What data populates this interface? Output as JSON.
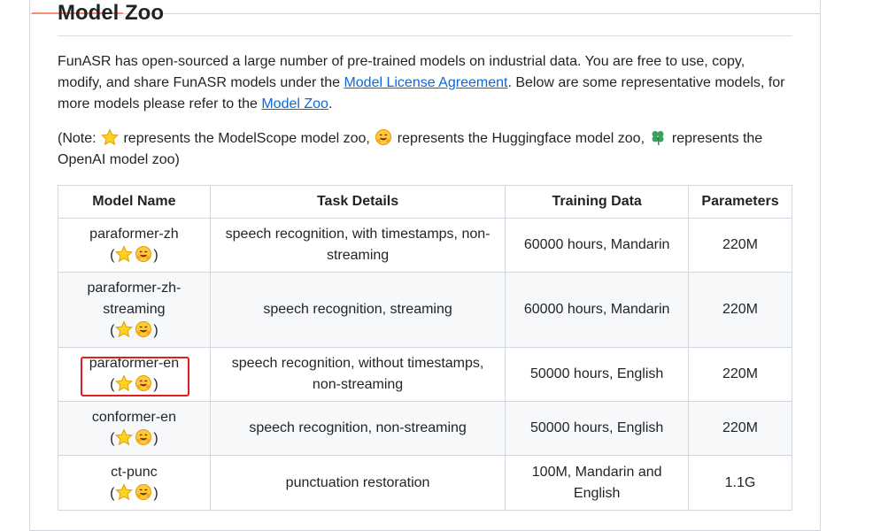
{
  "section": {
    "title": "Model Zoo"
  },
  "intro": {
    "text_before_link1": "FunASR has open-sourced a large number of pre-trained models on industrial data. You are free to use, copy, modify, and share FunASR models under the ",
    "link1": "Model License Agreement",
    "text_between": ". Below are some representative models, for more models please refer to the ",
    "link2": "Model Zoo",
    "text_after": "."
  },
  "note": {
    "part1": "(Note: ",
    "part2": " represents the ModelScope model zoo, ",
    "part3": " represents the Huggingface model zoo, ",
    "part4": " represents the OpenAI model zoo)"
  },
  "icons": {
    "modelscope": "star-icon",
    "huggingface": "hugging-face-icon",
    "openai": "four-leaf-clover-icon"
  },
  "table": {
    "headers": [
      "Model Name",
      "Task Details",
      "Training Data",
      "Parameters"
    ],
    "rows": [
      {
        "name": "paraformer-zh",
        "task": "speech recognition, with timestamps, non-streaming",
        "data": "60000 hours, Mandarin",
        "params": "220M"
      },
      {
        "name": "paraformer-zh-streaming",
        "task": "speech recognition, streaming",
        "data": "60000 hours, Mandarin",
        "params": "220M"
      },
      {
        "name": "paraformer-en",
        "task": "speech recognition, without timestamps, non-streaming",
        "data": "50000 hours, English",
        "params": "220M"
      },
      {
        "name": "conformer-en",
        "task": "speech recognition, non-streaming",
        "data": "50000 hours, English",
        "params": "220M"
      },
      {
        "name": "ct-punc",
        "task": "punctuation restoration",
        "data": "100M, Mandarin and English",
        "params": "1.1G"
      }
    ],
    "icon_open": "(",
    "icon_close": ")"
  },
  "colors": {
    "link": "#0969da",
    "highlight": "#e0201e",
    "accent": "#fd8c73"
  }
}
